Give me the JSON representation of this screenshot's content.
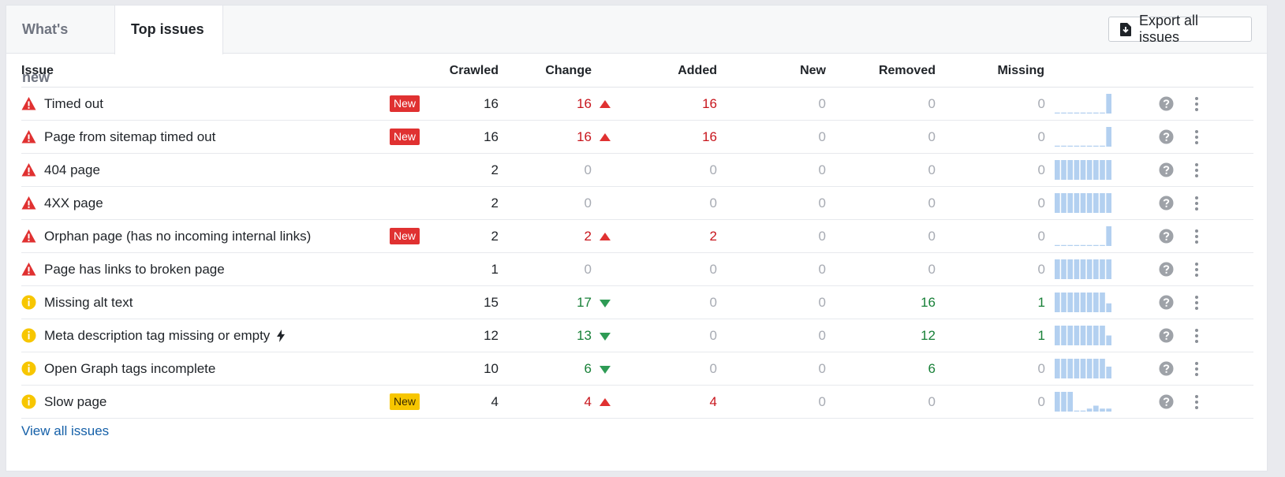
{
  "tabs": [
    {
      "label": "What's new",
      "active": false
    },
    {
      "label": "Top issues",
      "active": true
    }
  ],
  "export_label": "Export all issues",
  "columns": {
    "issue": "Issue",
    "crawled": "Crawled",
    "change": "Change",
    "added": "Added",
    "new": "New",
    "removed": "Removed",
    "missing": "Missing"
  },
  "colors": {
    "error": "#e03131",
    "warning": "#f7c600",
    "increase": "#c8161d",
    "decrease": "#188038",
    "spark": "#b3d0f0",
    "link": "#1560a8"
  },
  "rows": [
    {
      "severity": "error-icon",
      "name": "Timed out",
      "badge": "New",
      "badge_color": "red",
      "crawled": "16",
      "change": "16",
      "trend": "up",
      "added": "16",
      "new": "0",
      "removed": "0",
      "missing": "0",
      "spark": [
        0.05,
        0.05,
        0.05,
        0.05,
        0.05,
        0.05,
        0.05,
        0.05,
        1
      ]
    },
    {
      "severity": "error-icon",
      "name": "Page from sitemap timed out",
      "badge": "New",
      "badge_color": "red",
      "crawled": "16",
      "change": "16",
      "trend": "up",
      "added": "16",
      "new": "0",
      "removed": "0",
      "missing": "0",
      "spark": [
        0.05,
        0.05,
        0.05,
        0.05,
        0.05,
        0.05,
        0.05,
        0.05,
        1
      ]
    },
    {
      "severity": "error-icon",
      "name": "404 page",
      "badge": "",
      "crawled": "2",
      "change": "0",
      "trend": "",
      "added": "0",
      "new": "0",
      "removed": "0",
      "missing": "0",
      "spark": [
        1,
        1,
        1,
        1,
        1,
        1,
        1,
        1,
        1
      ]
    },
    {
      "severity": "error-icon",
      "name": "4XX page",
      "badge": "",
      "crawled": "2",
      "change": "0",
      "trend": "",
      "added": "0",
      "new": "0",
      "removed": "0",
      "missing": "0",
      "spark": [
        1,
        1,
        1,
        1,
        1,
        1,
        1,
        1,
        1
      ]
    },
    {
      "severity": "error-icon",
      "name": "Orphan page (has no incoming internal links)",
      "badge": "New",
      "badge_color": "red",
      "crawled": "2",
      "change": "2",
      "trend": "up",
      "added": "2",
      "new": "0",
      "removed": "0",
      "missing": "0",
      "spark": [
        0.05,
        0.05,
        0.05,
        0.05,
        0.05,
        0.05,
        0.05,
        0.05,
        1
      ]
    },
    {
      "severity": "error-icon",
      "name": "Page has links to broken page",
      "badge": "",
      "crawled": "1",
      "change": "0",
      "trend": "",
      "added": "0",
      "new": "0",
      "removed": "0",
      "missing": "0",
      "spark": [
        1,
        1,
        1,
        1,
        1,
        1,
        1,
        1,
        1
      ]
    },
    {
      "severity": "warning-icon",
      "name": "Missing alt text",
      "badge": "",
      "crawled": "15",
      "change": "17",
      "trend": "down",
      "added": "0",
      "new": "0",
      "removed": "16",
      "missing": "1",
      "spark": [
        1,
        1,
        1,
        1,
        1,
        1,
        1,
        1,
        0.45
      ]
    },
    {
      "severity": "warning-icon",
      "name": "Meta description tag missing or empty",
      "bolt": true,
      "badge": "",
      "crawled": "12",
      "change": "13",
      "trend": "down",
      "added": "0",
      "new": "0",
      "removed": "12",
      "missing": "1",
      "spark": [
        1,
        1,
        1,
        1,
        1,
        1,
        1,
        1,
        0.5
      ]
    },
    {
      "severity": "warning-icon",
      "name": "Open Graph tags incomplete",
      "badge": "",
      "crawled": "10",
      "change": "6",
      "trend": "down",
      "added": "0",
      "new": "0",
      "removed": "6",
      "missing": "0",
      "spark": [
        1,
        1,
        1,
        1,
        1,
        1,
        1,
        1,
        0.6
      ]
    },
    {
      "severity": "warning-icon",
      "name": "Slow page",
      "badge": "New",
      "badge_color": "yellow",
      "crawled": "4",
      "change": "4",
      "trend": "up",
      "added": "4",
      "new": "0",
      "removed": "0",
      "missing": "0",
      "spark": [
        1,
        1,
        1,
        0.05,
        0.05,
        0.15,
        0.3,
        0.15,
        0.15
      ]
    }
  ],
  "view_all_label": "View all issues"
}
